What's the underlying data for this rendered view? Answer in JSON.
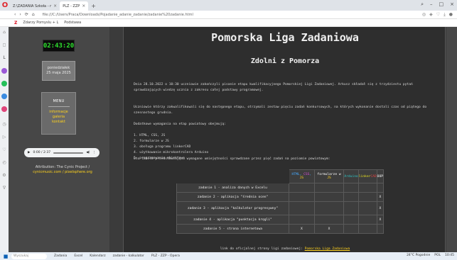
{
  "browser": {
    "tabs": [
      {
        "label": "Z:\\ZADANIA Szkoła - r",
        "active": false
      },
      {
        "label": "PLZ - ZZP",
        "active": true
      }
    ],
    "new_tab": "+",
    "url": "file:///C:/Users/Praca/Downloads/Pojadanie_adanie_zadanie/zadanie%20zadanie.html",
    "bookmarks": [
      "Zdarzy Pomyslu + L",
      "Podstawa"
    ]
  },
  "page": {
    "clock": "02:43:20",
    "date_lines": [
      "poniedziałek",
      "25 maja 2025"
    ],
    "menu": {
      "title": "MENU",
      "items": [
        "informacje",
        "galeria",
        "kontakt"
      ]
    },
    "audio": {
      "time": "0:00 / 2:37"
    },
    "attribution": {
      "text": "Attribution: The Cynic Project /",
      "link": "cynicmusic.com / pixelsphere.org"
    },
    "title": "Pomorska Liga Zadaniowa",
    "subtitle": "Zdolni z Pomorza",
    "paragraphs": [
      "Dnia 28.10.2022 o 10:30 uczniowie zakończyli pisanie etapu kwalifikacyjnego Pomorskiej Ligi Zadaniowej. Arkusz składał się z trzydziestu pytań sprawdzających wiedzę ucznia z zakresu całej podstawy programowej.",
      "Uczniowie którzy zakwalifikowali się do następnego etapu, otrzymali zestaw pięciu zadań konkursowych, na których wykonanie dostali czas od piątego do szesnastego grudnia.",
      "Dodatkowe wymagania na etap powiatowy obejmują:"
    ],
    "requirements": [
      "1. HTML, CSS, JS",
      "2. formularze w JS",
      "3. obsługa programu linkerCAD",
      "4. użytkowanie mikrokontrolera Arduino",
      "5. programowanie obiektowe"
    ],
    "table_intro": "Oto tabela przedstawiająca wymagane umiejętności sprawdzane przez pięć zadań na poziomie powiatowym:",
    "table": {
      "headers": {
        "html": "HTML",
        "css": "CSS",
        "js": "JS",
        "form": "formularze w",
        "form_js": "JS",
        "arduino": "Arduino",
        "linker": "linker",
        "cad": "CAD",
        "oop": "OOP"
      },
      "rows": [
        {
          "task": "zadanie 1 - analiza danych w Excelu",
          "marks": [
            "",
            "",
            "",
            "",
            ""
          ]
        },
        {
          "task": "zadanie 2 - aplikacja \"średnia ocen\"",
          "marks": [
            "",
            "",
            "",
            "",
            "X"
          ]
        },
        {
          "task": "zadanie 3 - aplikacja \"kalkulator progresywny\"",
          "marks": [
            "",
            "",
            "",
            "",
            "X"
          ]
        },
        {
          "task": "zadanie 4 - aplikacja \"punktacja kręgli\"",
          "marks": [
            "",
            "",
            "",
            "",
            "X"
          ]
        },
        {
          "task": "zadanie 5 - strona internetowa",
          "marks": [
            "X",
            "X",
            "",
            "",
            ""
          ]
        }
      ]
    },
    "footer": {
      "text": "link do oficjalnej strony ligi zadaniowej:",
      "link": "Pomorska Liga Zadaniowa"
    }
  },
  "taskbar": {
    "search": "Wyszukaj",
    "apps": [
      "Zadania",
      "Excel",
      "Kalendarz",
      "zadanie - kalkulator",
      "PLZ - ZZP - Opera"
    ],
    "right": [
      "24°C Pogodnie",
      "POL",
      "10:45"
    ]
  }
}
